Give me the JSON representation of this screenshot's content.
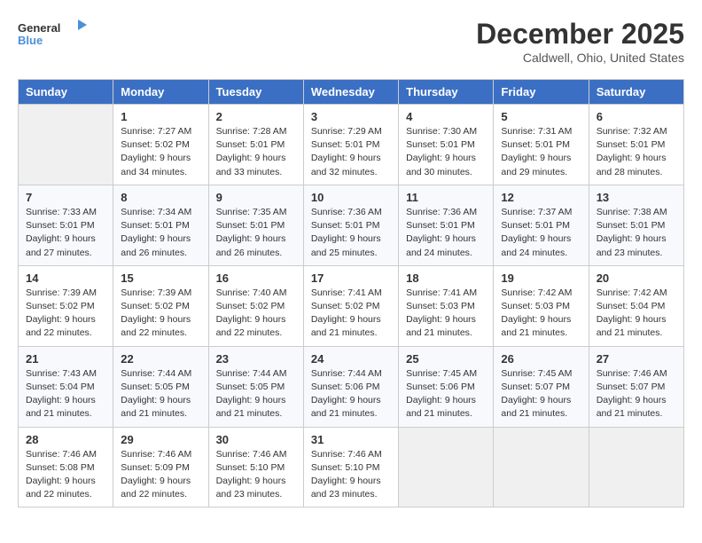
{
  "header": {
    "logo_line1": "General",
    "logo_line2": "Blue",
    "month": "December 2025",
    "location": "Caldwell, Ohio, United States"
  },
  "weekdays": [
    "Sunday",
    "Monday",
    "Tuesday",
    "Wednesday",
    "Thursday",
    "Friday",
    "Saturday"
  ],
  "weeks": [
    [
      {
        "day": "",
        "info": ""
      },
      {
        "day": "1",
        "info": "Sunrise: 7:27 AM\nSunset: 5:02 PM\nDaylight: 9 hours\nand 34 minutes."
      },
      {
        "day": "2",
        "info": "Sunrise: 7:28 AM\nSunset: 5:01 PM\nDaylight: 9 hours\nand 33 minutes."
      },
      {
        "day": "3",
        "info": "Sunrise: 7:29 AM\nSunset: 5:01 PM\nDaylight: 9 hours\nand 32 minutes."
      },
      {
        "day": "4",
        "info": "Sunrise: 7:30 AM\nSunset: 5:01 PM\nDaylight: 9 hours\nand 30 minutes."
      },
      {
        "day": "5",
        "info": "Sunrise: 7:31 AM\nSunset: 5:01 PM\nDaylight: 9 hours\nand 29 minutes."
      },
      {
        "day": "6",
        "info": "Sunrise: 7:32 AM\nSunset: 5:01 PM\nDaylight: 9 hours\nand 28 minutes."
      }
    ],
    [
      {
        "day": "7",
        "info": "Sunrise: 7:33 AM\nSunset: 5:01 PM\nDaylight: 9 hours\nand 27 minutes."
      },
      {
        "day": "8",
        "info": "Sunrise: 7:34 AM\nSunset: 5:01 PM\nDaylight: 9 hours\nand 26 minutes."
      },
      {
        "day": "9",
        "info": "Sunrise: 7:35 AM\nSunset: 5:01 PM\nDaylight: 9 hours\nand 26 minutes."
      },
      {
        "day": "10",
        "info": "Sunrise: 7:36 AM\nSunset: 5:01 PM\nDaylight: 9 hours\nand 25 minutes."
      },
      {
        "day": "11",
        "info": "Sunrise: 7:36 AM\nSunset: 5:01 PM\nDaylight: 9 hours\nand 24 minutes."
      },
      {
        "day": "12",
        "info": "Sunrise: 7:37 AM\nSunset: 5:01 PM\nDaylight: 9 hours\nand 24 minutes."
      },
      {
        "day": "13",
        "info": "Sunrise: 7:38 AM\nSunset: 5:01 PM\nDaylight: 9 hours\nand 23 minutes."
      }
    ],
    [
      {
        "day": "14",
        "info": "Sunrise: 7:39 AM\nSunset: 5:02 PM\nDaylight: 9 hours\nand 22 minutes."
      },
      {
        "day": "15",
        "info": "Sunrise: 7:39 AM\nSunset: 5:02 PM\nDaylight: 9 hours\nand 22 minutes."
      },
      {
        "day": "16",
        "info": "Sunrise: 7:40 AM\nSunset: 5:02 PM\nDaylight: 9 hours\nand 22 minutes."
      },
      {
        "day": "17",
        "info": "Sunrise: 7:41 AM\nSunset: 5:02 PM\nDaylight: 9 hours\nand 21 minutes."
      },
      {
        "day": "18",
        "info": "Sunrise: 7:41 AM\nSunset: 5:03 PM\nDaylight: 9 hours\nand 21 minutes."
      },
      {
        "day": "19",
        "info": "Sunrise: 7:42 AM\nSunset: 5:03 PM\nDaylight: 9 hours\nand 21 minutes."
      },
      {
        "day": "20",
        "info": "Sunrise: 7:42 AM\nSunset: 5:04 PM\nDaylight: 9 hours\nand 21 minutes."
      }
    ],
    [
      {
        "day": "21",
        "info": "Sunrise: 7:43 AM\nSunset: 5:04 PM\nDaylight: 9 hours\nand 21 minutes."
      },
      {
        "day": "22",
        "info": "Sunrise: 7:44 AM\nSunset: 5:05 PM\nDaylight: 9 hours\nand 21 minutes."
      },
      {
        "day": "23",
        "info": "Sunrise: 7:44 AM\nSunset: 5:05 PM\nDaylight: 9 hours\nand 21 minutes."
      },
      {
        "day": "24",
        "info": "Sunrise: 7:44 AM\nSunset: 5:06 PM\nDaylight: 9 hours\nand 21 minutes."
      },
      {
        "day": "25",
        "info": "Sunrise: 7:45 AM\nSunset: 5:06 PM\nDaylight: 9 hours\nand 21 minutes."
      },
      {
        "day": "26",
        "info": "Sunrise: 7:45 AM\nSunset: 5:07 PM\nDaylight: 9 hours\nand 21 minutes."
      },
      {
        "day": "27",
        "info": "Sunrise: 7:46 AM\nSunset: 5:07 PM\nDaylight: 9 hours\nand 21 minutes."
      }
    ],
    [
      {
        "day": "28",
        "info": "Sunrise: 7:46 AM\nSunset: 5:08 PM\nDaylight: 9 hours\nand 22 minutes."
      },
      {
        "day": "29",
        "info": "Sunrise: 7:46 AM\nSunset: 5:09 PM\nDaylight: 9 hours\nand 22 minutes."
      },
      {
        "day": "30",
        "info": "Sunrise: 7:46 AM\nSunset: 5:10 PM\nDaylight: 9 hours\nand 23 minutes."
      },
      {
        "day": "31",
        "info": "Sunrise: 7:46 AM\nSunset: 5:10 PM\nDaylight: 9 hours\nand 23 minutes."
      },
      {
        "day": "",
        "info": ""
      },
      {
        "day": "",
        "info": ""
      },
      {
        "day": "",
        "info": ""
      }
    ]
  ]
}
